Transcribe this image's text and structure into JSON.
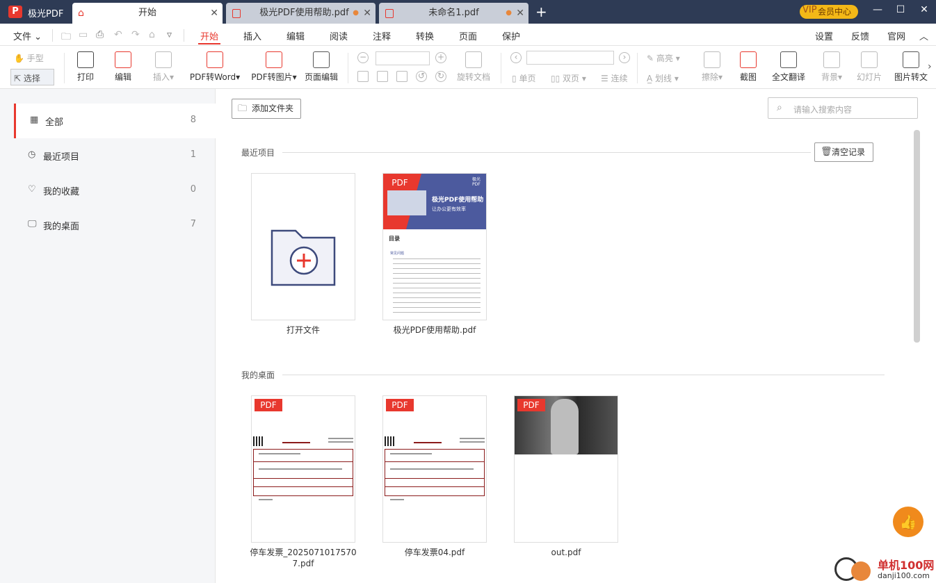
{
  "app": {
    "name": "极光PDF",
    "logo_letter": "P"
  },
  "tabs": [
    {
      "label": "开始",
      "active": true
    },
    {
      "label": "极光PDF使用帮助.pdf",
      "active": false
    },
    {
      "label": "未命名1.pdf",
      "active": false
    }
  ],
  "vip": {
    "label": "会员中心",
    "badge": "VIP"
  },
  "menu": {
    "file": "文件",
    "items": [
      "开始",
      "插入",
      "编辑",
      "阅读",
      "注释",
      "转换",
      "页面",
      "保护"
    ],
    "right": [
      "设置",
      "反馈",
      "官网"
    ]
  },
  "toolbar": {
    "hand": "手型",
    "select": "选择",
    "print": "打印",
    "edit": "编辑",
    "insert": "插入",
    "pdf_to_word": "PDF转Word",
    "pdf_to_image": "PDF转图片",
    "page_edit": "页面编辑",
    "rotate_doc": "旋转文档",
    "single": "单页",
    "double": "双页",
    "continuous": "连续",
    "highlight": "高亮",
    "strike": "划线",
    "erase": "擦除",
    "screenshot": "截图",
    "translate": "全文翻译",
    "background": "背景",
    "slideshow": "幻灯片",
    "img_to_text": "图片转文"
  },
  "sidebar": {
    "items": [
      {
        "label": "全部",
        "count": "8",
        "icon": "grid-icon"
      },
      {
        "label": "最近项目",
        "count": "1",
        "icon": "clock-icon"
      },
      {
        "label": "我的收藏",
        "count": "0",
        "icon": "heart-icon"
      },
      {
        "label": "我的桌面",
        "count": "7",
        "icon": "monitor-icon"
      }
    ]
  },
  "main": {
    "add_folder": "添加文件夹",
    "search_placeholder": "请输入搜索内容",
    "recent_title": "最近项目",
    "clear_records": "清空记录",
    "desktop_title": "我的桌面",
    "pdf_tag": "PDF",
    "recent_files": [
      {
        "name": "打开文件"
      },
      {
        "name": "极光PDF使用帮助.pdf"
      }
    ],
    "desktop_files": [
      {
        "name": "停车发票_2025071017570 7.pdf"
      },
      {
        "name": "停车发票04.pdf"
      },
      {
        "name": "out.pdf"
      }
    ],
    "help_cover": {
      "title": "极光PDF使用帮助",
      "subtitle": "让办公更有效率",
      "brand": "极光PDF",
      "toc": "目录",
      "toc_head": "常见问题"
    }
  },
  "watermark": {
    "name": "单机100网",
    "url": "danji100.com"
  }
}
